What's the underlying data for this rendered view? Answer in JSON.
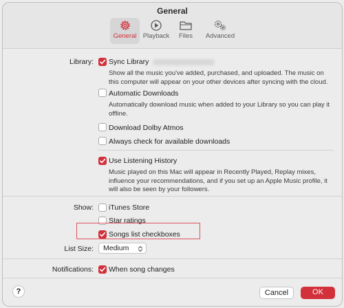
{
  "window": {
    "title": "General"
  },
  "toolbar": {
    "tabs": [
      {
        "label": "General",
        "icon": "gear-icon",
        "active": true
      },
      {
        "label": "Playback",
        "icon": "play-circle-icon",
        "active": false
      },
      {
        "label": "Files",
        "icon": "folder-icon",
        "active": false
      },
      {
        "label": "Advanced",
        "icon": "gears-icon",
        "active": false
      }
    ]
  },
  "library": {
    "label": "Library:",
    "sync_library": "Sync Library",
    "sync_desc": "Show all the music you've added, purchased, and uploaded. The music on this computer will appear on your other devices after syncing with the cloud.",
    "auto_downloads": "Automatic Downloads",
    "auto_desc": "Automatically download music when added to your Library so you can play it offline.",
    "dolby": "Download Dolby Atmos",
    "always_check": "Always check for available downloads",
    "listening_history": "Use Listening History",
    "listening_desc": "Music played on this Mac will appear in Recently Played, Replay mixes, influence your recommendations, and if you set up an Apple Music profile, it will also be seen by your followers."
  },
  "show": {
    "label": "Show:",
    "itunes_store": "iTunes Store",
    "star_ratings": "Star ratings",
    "songs_list": "Songs list checkboxes"
  },
  "list_size": {
    "label": "List Size:",
    "value": "Medium"
  },
  "notifications": {
    "label": "Notifications:",
    "when_song_changes": "When song changes"
  },
  "footer": {
    "help": "?",
    "cancel": "Cancel",
    "ok": "OK"
  },
  "colors": {
    "accent": "#d2303b",
    "highlight_box": "#d9535d"
  }
}
